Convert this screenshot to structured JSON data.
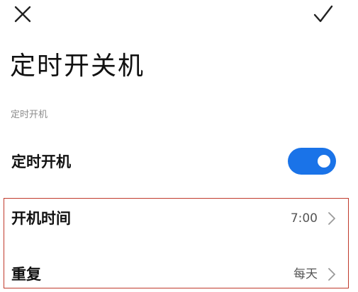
{
  "top_bar": {
    "close_icon": "close-icon",
    "confirm_icon": "check-icon"
  },
  "page": {
    "title": "定时开关机"
  },
  "section": {
    "label": "定时开机"
  },
  "toggle_row": {
    "label": "定时开机",
    "enabled": true,
    "accent_color": "#1a73e8"
  },
  "settings": {
    "time": {
      "label": "开机时间",
      "value": "7:00"
    },
    "repeat": {
      "label": "重复",
      "value": "每天"
    }
  },
  "colors": {
    "highlight_border": "#c0392b",
    "secondary_text": "#8c8c8c"
  }
}
